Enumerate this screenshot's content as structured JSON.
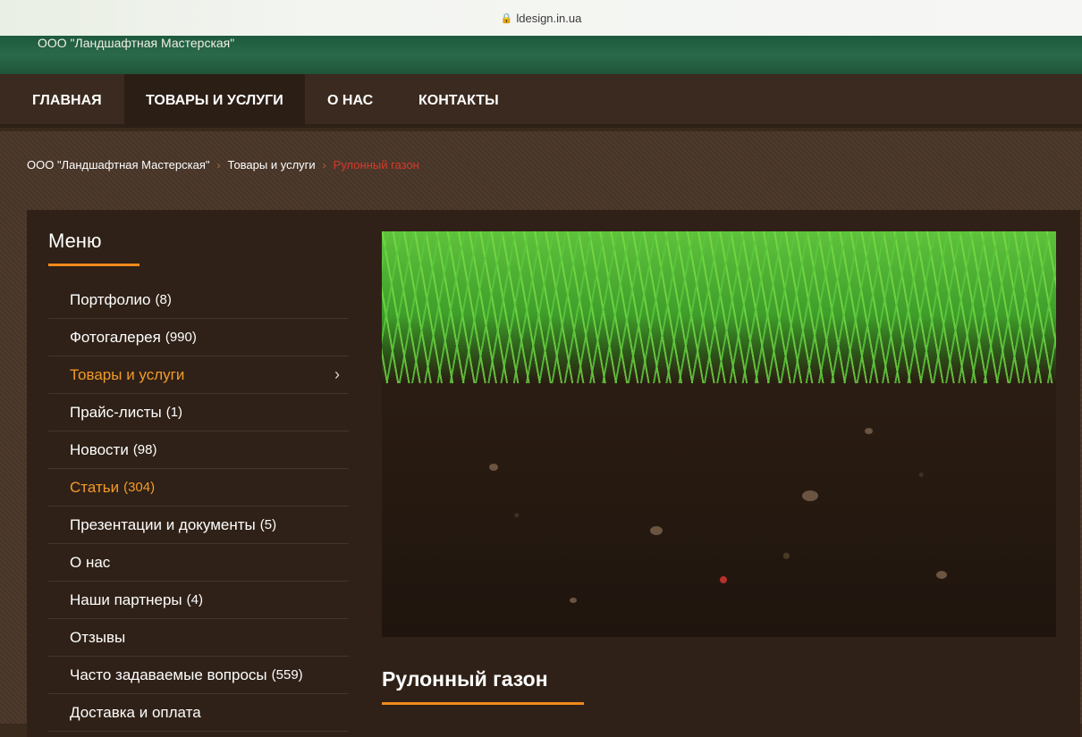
{
  "browser": {
    "url": "ldesign.in.ua"
  },
  "site": {
    "title": "ООО \"Ландшафтная Мастерская\""
  },
  "nav": {
    "items": [
      {
        "label": "ГЛАВНАЯ"
      },
      {
        "label": "ТОВАРЫ И УСЛУГИ"
      },
      {
        "label": "О НАС"
      },
      {
        "label": "КОНТАКТЫ"
      }
    ]
  },
  "breadcrumb": {
    "home": "ООО \"Ландшафтная Мастерская\"",
    "section": "Товары и услуги",
    "current": "Рулонный газон"
  },
  "menu": {
    "title": "Меню",
    "items": [
      {
        "label": "Портфолио",
        "count": "(8)"
      },
      {
        "label": "Фотогалерея",
        "count": "(990)"
      },
      {
        "label": "Товары и услуги",
        "count": ""
      },
      {
        "label": "Прайс-листы",
        "count": "(1)"
      },
      {
        "label": "Новости",
        "count": "(98)"
      },
      {
        "label": "Статьи",
        "count": "(304)"
      },
      {
        "label": "Презентации и документы",
        "count": "(5)"
      },
      {
        "label": "О нас",
        "count": ""
      },
      {
        "label": "Наши партнеры",
        "count": "(4)"
      },
      {
        "label": "Отзывы",
        "count": ""
      },
      {
        "label": "Часто задаваемые вопросы",
        "count": "(559)"
      },
      {
        "label": "Доставка и оплата",
        "count": ""
      }
    ]
  },
  "content": {
    "title": "Рулонный газон"
  },
  "colors": {
    "accent": "#f08a1c",
    "active_link": "#f39a2b",
    "breadcrumb_current": "#d83a2a"
  }
}
